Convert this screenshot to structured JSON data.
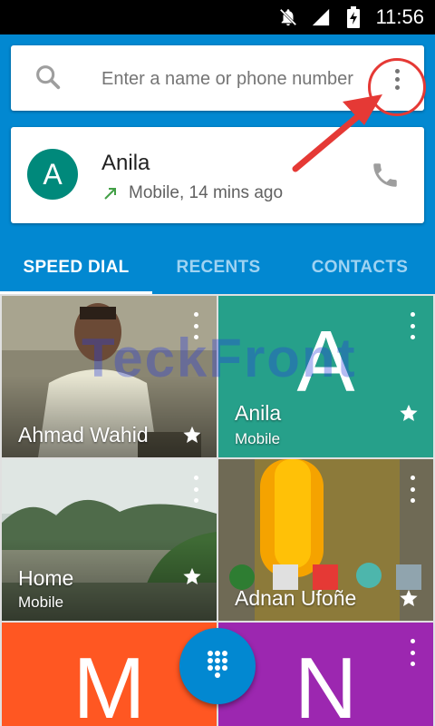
{
  "status_bar": {
    "time": "11:56",
    "icons": [
      "notifications-off-icon",
      "signal-icon",
      "battery-charging-icon"
    ]
  },
  "search": {
    "placeholder": "Enter a name or phone number",
    "icon": "search-icon",
    "menu_icon": "overflow-menu-icon"
  },
  "recent_call": {
    "avatar_letter": "A",
    "avatar_color": "#00897b",
    "name": "Anila",
    "detail": "Mobile, 14 mins ago",
    "call_type_icon": "outgoing-call-arrow-icon",
    "action_icon": "phone-icon"
  },
  "tabs": [
    {
      "label": "SPEED DIAL",
      "active": true
    },
    {
      "label": "RECENTS",
      "active": false
    },
    {
      "label": "CONTACTS",
      "active": false
    }
  ],
  "speed_dial": [
    {
      "name": "Ahmad Wahid",
      "label": "",
      "starred": true
    },
    {
      "name": "Anila",
      "label": "Mobile",
      "letter": "A",
      "color": "#26a08a",
      "starred": true
    },
    {
      "name": "Home",
      "label": "Mobile",
      "starred": true
    },
    {
      "name": "Adnan Ufoñe",
      "label": "",
      "starred": true
    },
    {
      "name": "",
      "label": "",
      "letter": "M",
      "color": "#ff5722"
    },
    {
      "name": "",
      "label": "",
      "letter": "N",
      "color": "#9c27b0"
    }
  ],
  "watermark": "TeckFront",
  "fab_icon": "dialpad-icon",
  "colors": {
    "primary": "#0288d1",
    "annotation": "#e53935"
  }
}
